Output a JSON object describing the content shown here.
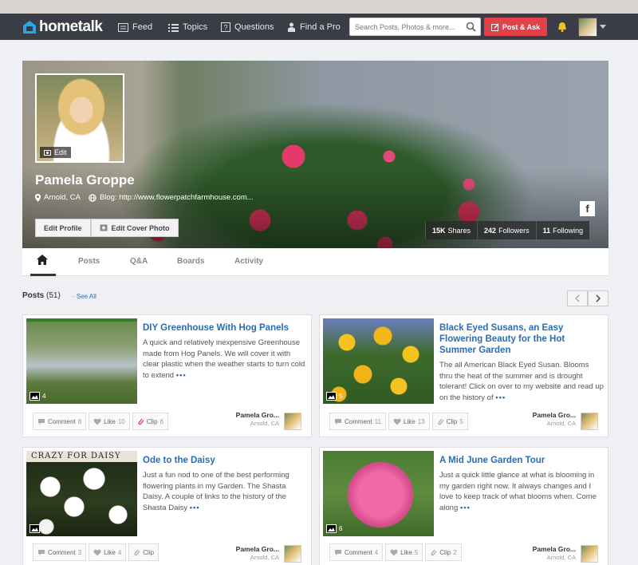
{
  "nav": {
    "brand": "hometalk",
    "items": [
      {
        "label": "Feed",
        "icon": "feed-icon"
      },
      {
        "label": "Topics",
        "icon": "list-icon"
      },
      {
        "label": "Questions",
        "icon": "question-icon"
      },
      {
        "label": "Find a Pro",
        "icon": "pro-icon"
      }
    ],
    "search_placeholder": "Search Posts, Photos & more...",
    "post_ask_label": "Post & Ask"
  },
  "profile": {
    "name": "Pamela Groppe",
    "location": "Arnold, CA",
    "blog": "Blog: http://www.flowerpatchfarmhouse.com...",
    "photo_edit_label": "Edit",
    "edit_profile_label": "Edit Profile",
    "edit_cover_label": "Edit Cover Photo",
    "facebook_label": "f",
    "stats": [
      {
        "value": "15K",
        "label": "Shares"
      },
      {
        "value": "242",
        "label": "Followers"
      },
      {
        "value": "11",
        "label": "Following"
      }
    ]
  },
  "tabs": [
    "Posts",
    "Q&A",
    "Boards",
    "Activity"
  ],
  "posts_section": {
    "label": "Posts",
    "count": "(51)",
    "see_all": "· See All"
  },
  "posts": [
    {
      "title": "DIY Greenhouse With Hog Panels",
      "description": "A quick and relatively inexpensive Greenhouse made from Hog Panels. We will cover it with clear plastic when the weather starts to turn cold to extend",
      "photo_count": "4",
      "comment_label": "Comment",
      "comment_count": "8",
      "like_label": "Like",
      "like_count": "10",
      "clip_label": "Clip",
      "clip_count": "6",
      "author": "Pamela Gro...",
      "author_location": "Arnold, CA"
    },
    {
      "title": "Black Eyed Susans, an Easy Flowering Beauty for the Hot Summer Garden",
      "description": "The all American Black Eyed Susan. Blooms thru the heat of the summer and is drought tolerant! Click on over to my website and read up on the history of",
      "photo_count": "5",
      "comment_label": "Comment",
      "comment_count": "11",
      "like_label": "Like",
      "like_count": "13",
      "clip_label": "Clip",
      "clip_count": "5",
      "author": "Pamela Gro...",
      "author_location": "Arnold, CA"
    },
    {
      "title": "Ode to the Daisy",
      "description": "Just a fun nod to one of the best performing flowering plants in my Garden. The Shasta Daisy. A couple of links to the history of the Shasta Daisy",
      "photo_count": "5",
      "image_banner": "CRAZY FOR DAISY",
      "comment_label": "Comment",
      "comment_count": "3",
      "like_label": "Like",
      "like_count": "4",
      "clip_label": "Clip",
      "clip_count": "",
      "author": "Pamela Gro...",
      "author_location": "Arnold, CA"
    },
    {
      "title": "A Mid June Garden Tour",
      "description": "Just a quick little glance at what is blooming in my garden right now. It always changes and I love to keep track of what blooms when. Come along",
      "photo_count": "6",
      "comment_label": "Comment",
      "comment_count": "4",
      "like_label": "Like",
      "like_count": "5",
      "clip_label": "Clip",
      "clip_count": "2",
      "author": "Pamela Gro...",
      "author_location": "Arnold, CA"
    }
  ],
  "colors": {
    "navbar": "#3a3d45",
    "accent_red": "#e24247",
    "link_blue": "#2a6db3"
  }
}
